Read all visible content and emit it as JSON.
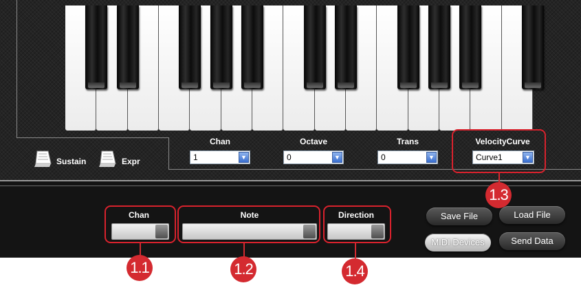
{
  "keyboard": {
    "white_keys": 15,
    "black_key_positions": [
      0,
      1,
      3,
      4,
      5,
      7,
      8,
      10,
      11,
      12,
      14
    ]
  },
  "pedals": {
    "sustain_label": "Sustain",
    "expr_label": "Expr"
  },
  "top_controls": {
    "chan": {
      "label": "Chan",
      "value": "1"
    },
    "octave": {
      "label": "Octave",
      "value": "0"
    },
    "trans": {
      "label": "Trans",
      "value": "0"
    },
    "velocity": {
      "label": "VelocityCurve",
      "value": "Curve1"
    }
  },
  "bottom_controls": {
    "chan_label": "Chan",
    "note_label": "Note",
    "direction_label": "Direction"
  },
  "buttons": {
    "save_file": "Save File",
    "load_file": "Load File",
    "midi_devices": "MIDI Devices",
    "send_data": "Send Data"
  },
  "callouts": {
    "c11": "1.1",
    "c12": "1.2",
    "c13": "1.3",
    "c14": "1.4"
  },
  "colors": {
    "highlight": "#d9222d",
    "badge": "#d42a30",
    "combo_button": "#3a6fcf"
  }
}
